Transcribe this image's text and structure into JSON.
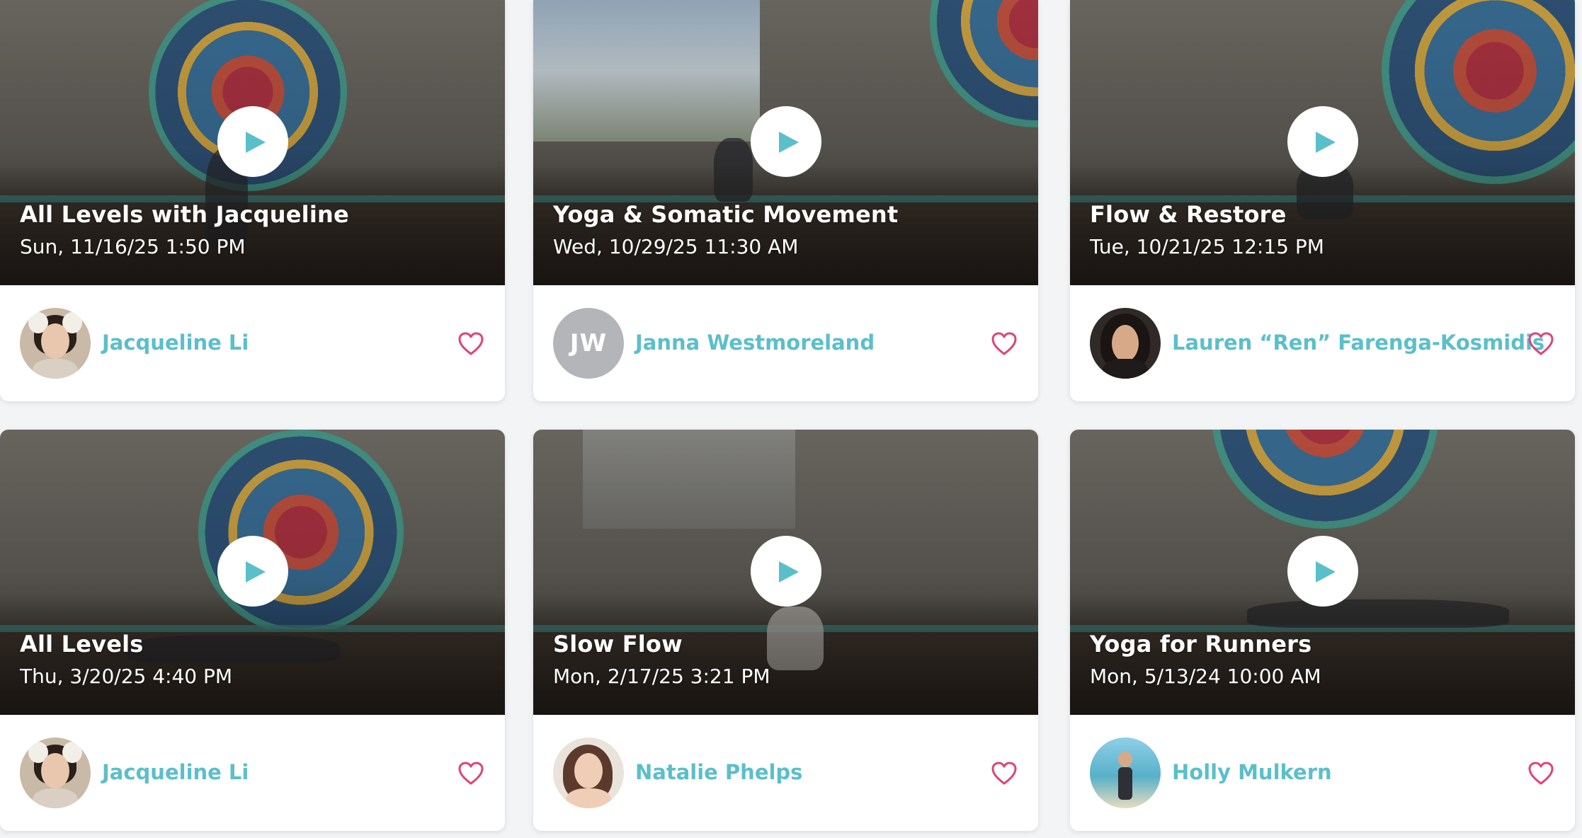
{
  "colors": {
    "accent": "#5bbfca",
    "heart": "#e0427a",
    "card_bg": "#ffffff",
    "page_bg": "#f3f4f6",
    "initials_bg": "#b3b5b8"
  },
  "cards": [
    {
      "title": "All Levels with Jacqueline",
      "datetime": "Sun, 11/16/25 1:50 PM",
      "instructor": "Jacqueline Li",
      "avatar_type": "photo",
      "avatar_initials": "",
      "icons": {
        "play": "play-icon",
        "favorite": "heart-outline-icon"
      }
    },
    {
      "title": "Yoga & Somatic Movement",
      "datetime": "Wed, 10/29/25 11:30 AM",
      "instructor": "Janna Westmoreland",
      "avatar_type": "initials",
      "avatar_initials": "JW",
      "icons": {
        "play": "play-icon",
        "favorite": "heart-outline-icon"
      }
    },
    {
      "title": "Flow & Restore",
      "datetime": "Tue, 10/21/25 12:15 PM",
      "instructor": "Lauren “Ren” Farenga-Kosmidis",
      "avatar_type": "photo",
      "avatar_initials": "",
      "icons": {
        "play": "play-icon",
        "favorite": "heart-outline-icon"
      }
    },
    {
      "title": "All Levels",
      "datetime": "Thu, 3/20/25 4:40 PM",
      "instructor": "Jacqueline Li",
      "avatar_type": "photo",
      "avatar_initials": "",
      "icons": {
        "play": "play-icon",
        "favorite": "heart-outline-icon"
      }
    },
    {
      "title": "Slow Flow",
      "datetime": "Mon, 2/17/25 3:21 PM",
      "instructor": "Natalie Phelps",
      "avatar_type": "photo",
      "avatar_initials": "",
      "icons": {
        "play": "play-icon",
        "favorite": "heart-outline-icon"
      }
    },
    {
      "title": "Yoga for Runners",
      "datetime": "Mon, 5/13/24 10:00 AM",
      "instructor": "Holly Mulkern",
      "avatar_type": "photo",
      "avatar_initials": "",
      "icons": {
        "play": "play-icon",
        "favorite": "heart-outline-icon"
      }
    }
  ]
}
